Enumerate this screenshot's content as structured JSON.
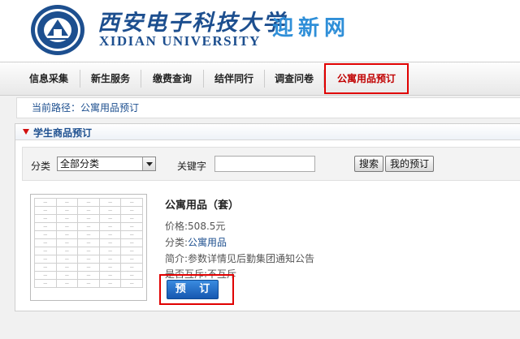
{
  "header": {
    "university_cn": "西安电子科技大学",
    "university_en": "XIDIAN UNIVERSITY",
    "site_name": "迎新网",
    "seal_top_text": "西安电子科技大学",
    "seal_bottom_text": "XIDIAN UNIVERSITY"
  },
  "nav": {
    "items": [
      {
        "label": "信息采集"
      },
      {
        "label": "新生服务"
      },
      {
        "label": "缴费查询"
      },
      {
        "label": "结伴同行"
      },
      {
        "label": "调查问卷"
      },
      {
        "label": "公寓用品预订"
      }
    ],
    "active_index": 5
  },
  "breadcrumb": {
    "prefix": "当前路径：",
    "current": "公寓用品预订"
  },
  "panel": {
    "title": "学生商品预订"
  },
  "filter": {
    "category_label": "分类",
    "category_selected": "全部分类",
    "keyword_label": "关键字",
    "keyword_value": "",
    "search_button": "搜索",
    "my_orders_button": "我的预订"
  },
  "product": {
    "name": "公寓用品（套）",
    "price_label": "价格:",
    "price_value": "508.5元",
    "category_label": "分类:",
    "category_value": "公寓用品",
    "intro_label": "简介:",
    "intro_value": "参数详情见后勤集团通知公告",
    "split_label": "是否互斥:",
    "split_value": "不互斥",
    "order_button": "预 订"
  },
  "colors": {
    "brand_blue": "#1d4f8f",
    "site_name_blue": "#2f8fd8",
    "highlight_red": "#e00000",
    "button_blue": "#1658b0"
  }
}
